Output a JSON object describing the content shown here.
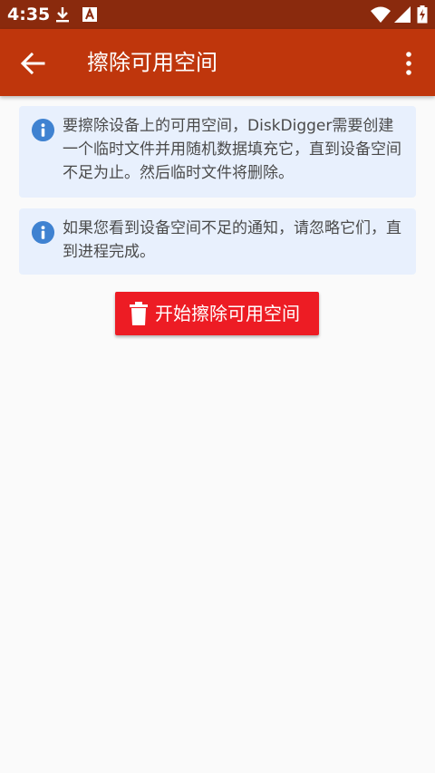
{
  "status_bar": {
    "time": "4:35",
    "icons": [
      "download-icon",
      "font-a-icon",
      "wifi-icon",
      "signal-icon",
      "battery-charging-icon"
    ]
  },
  "app_bar": {
    "title": "擦除可用空间",
    "back_icon": "arrow-back-icon",
    "menu_icon": "more-vert-icon",
    "color": "#bf360c"
  },
  "cards": [
    {
      "icon": "info-icon",
      "text": "要擦除设备上的可用空间，DiskDigger需要创建一个临时文件并用随机数据填充它，直到设备空间不足为止。然后临时文件将删除。"
    },
    {
      "icon": "info-icon",
      "text": "如果您看到设备空间不足的通知，请忽略它们，直到进程完成。"
    }
  ],
  "start_button": {
    "label": "开始擦除可用空间",
    "icon": "trash-icon",
    "color": "#ed1c24"
  },
  "colors": {
    "status_bar": "#8a2a0d",
    "info_bg": "#e8f0fd",
    "info_icon": "#3f82d1"
  }
}
